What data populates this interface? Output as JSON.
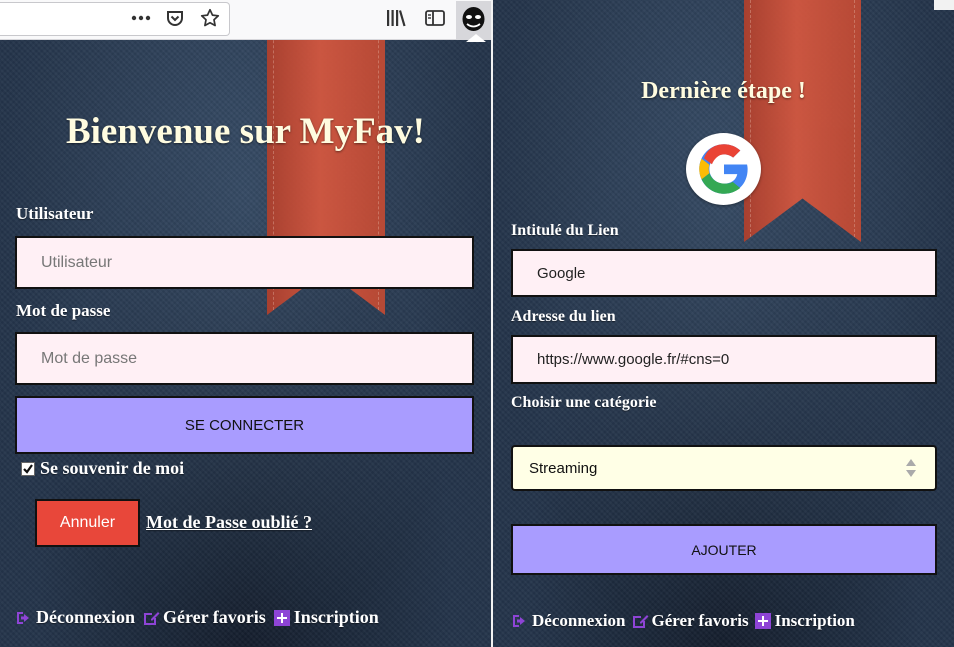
{
  "toolbar": {
    "overflow_icon": "dots-menu-icon",
    "pocket_icon": "pocket-icon",
    "bookmark_icon": "star-icon",
    "library_icon": "library-icon",
    "sidebar_icon": "sidebar-icon",
    "extension_icon": "extension-mask-icon"
  },
  "left": {
    "title": "Bienvenue sur MyFav!",
    "user_label": "Utilisateur",
    "user_placeholder": "Utilisateur",
    "password_label": "Mot de passe",
    "password_placeholder": "Mot de passe",
    "login_button": "SE CONNECTER",
    "remember_label": "Se souvenir de moi",
    "remember_checked": true,
    "cancel_button": "Annuler",
    "forgot_link": "Mot de Passe oublié ?",
    "nav": {
      "logout": "Déconnexion",
      "manage": "Gérer favoris",
      "signup": "Inscription"
    }
  },
  "right": {
    "title": "Dernière étape !",
    "logo": "google-logo",
    "link_title_label": "Intitulé du Lien",
    "link_title_value": "Google",
    "link_url_label": "Adresse du lien",
    "link_url_value": "https://www.google.fr/#cns=0",
    "category_label": "Choisir une catégorie",
    "category_value": "Streaming",
    "add_button": "AJOUTER",
    "nav": {
      "logout": "Déconnexion",
      "manage": "Gérer favoris",
      "signup": "Inscription"
    }
  },
  "colors": {
    "accent_button": "#a99cff",
    "cancel_button": "#e8473a",
    "field_bg": "#fff0f5",
    "select_bg": "#ffffe6",
    "nav_icon": "#8e44d6",
    "title_text": "#fffce0"
  }
}
